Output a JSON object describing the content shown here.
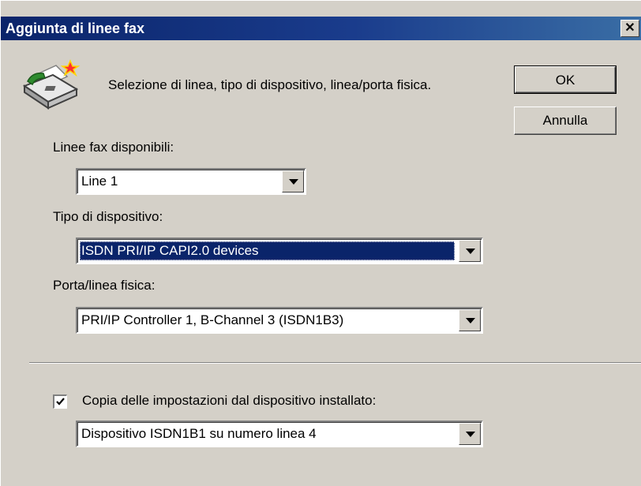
{
  "window": {
    "title": "Aggiunta di linee fax",
    "close_glyph": "✕"
  },
  "icons": {
    "fax": "fax-machine-icon",
    "close": "close-icon",
    "dropdown": "chevron-down-icon",
    "checkmark": "checkmark-icon"
  },
  "description": "Selezione di linea, tipo di dispositivo, linea/porta fisica.",
  "buttons": {
    "ok": "OK",
    "cancel": "Annulla"
  },
  "fields": {
    "fax_lines": {
      "label": "Linee fax disponibili:",
      "value": "Line 1"
    },
    "device_type": {
      "label": "Tipo di dispositivo:",
      "value": "ISDN PRI/IP CAPI2.0 devices"
    },
    "physical_port": {
      "label": "Porta/linea fisica:",
      "value": "PRI/IP Controller 1, B-Channel 3 (ISDN1B3)"
    },
    "copy_settings": {
      "label": "Copia delle impostazioni dal dispositivo installato:",
      "checked": true,
      "value": "Dispositivo ISDN1B1 su numero linea 4"
    }
  },
  "colors": {
    "titlebar": "#0a246a",
    "face": "#d4d0c8",
    "selection": "#0a246a"
  }
}
